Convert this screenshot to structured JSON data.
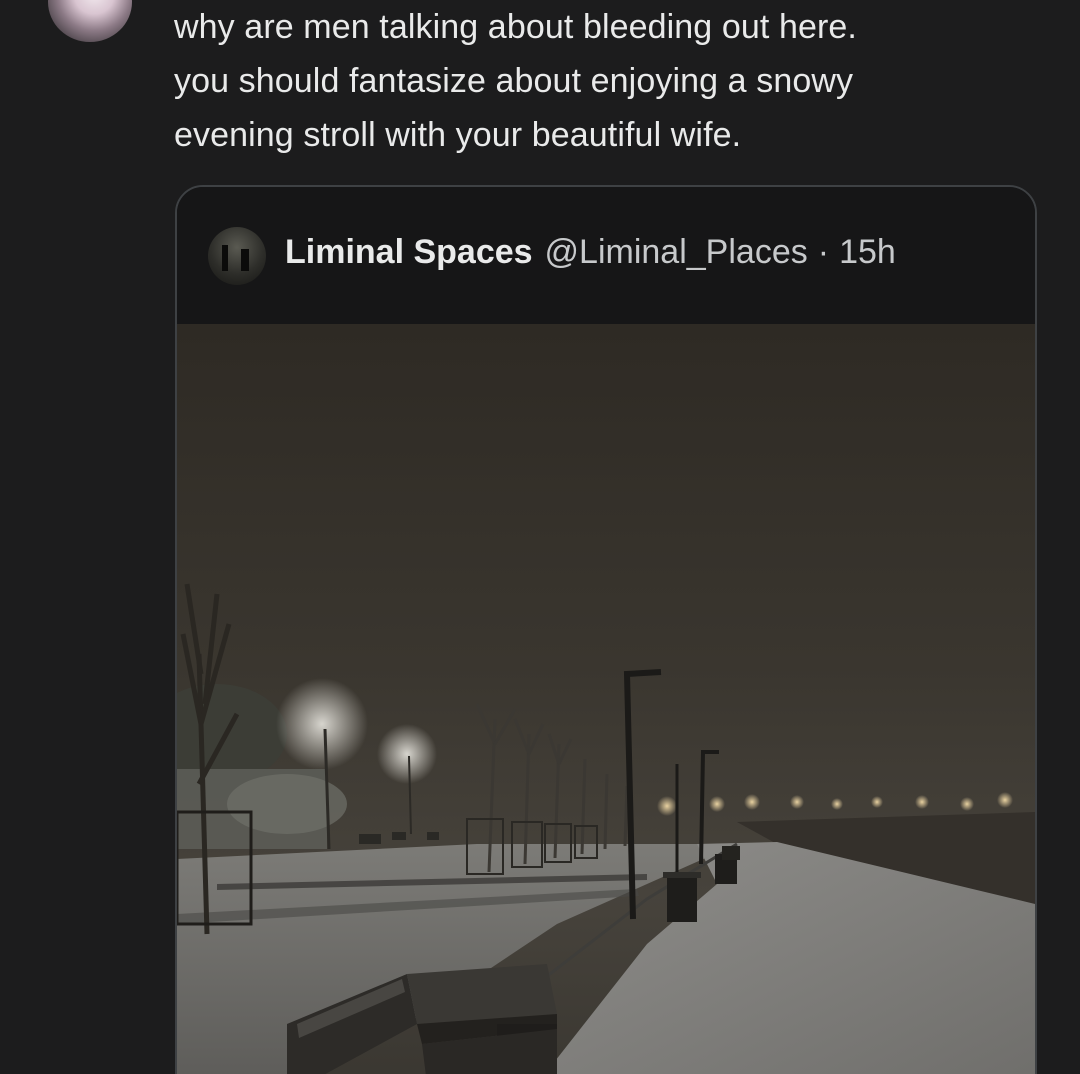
{
  "reply": {
    "text_lines": [
      "why are men talking about bleeding out here.",
      "you should fantasize about enjoying a snowy",
      "evening stroll with your beautiful wife."
    ]
  },
  "quoted_tweet": {
    "display_name": "Liminal Spaces",
    "handle": "@Liminal_Places",
    "separator": "·",
    "time": "15h",
    "media": {
      "type": "photo",
      "description_icon": "snowy-promenade-photo"
    }
  },
  "colors": {
    "background": "#1c1c1d",
    "text": "#e9eaea",
    "secondary_text": "#c7c9cb",
    "card_border": "#3e4144"
  }
}
